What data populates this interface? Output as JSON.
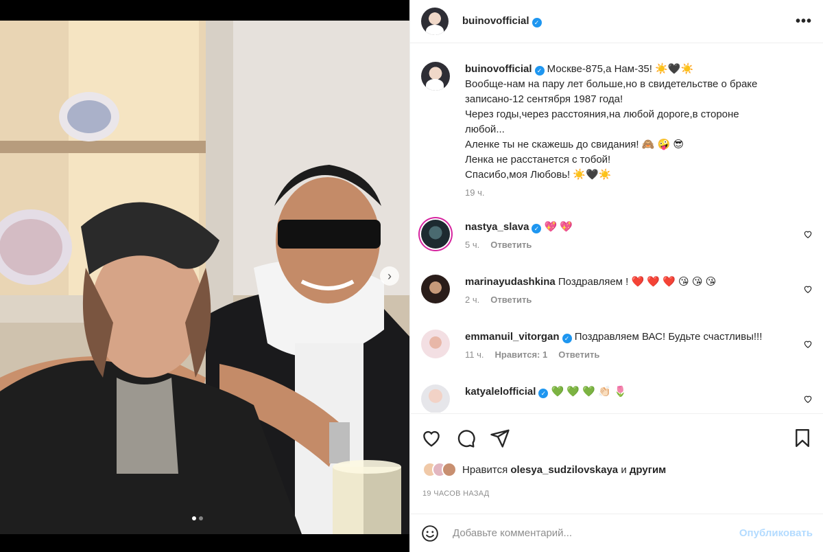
{
  "post": {
    "username": "buinovofficial",
    "verified_mark": "✓",
    "more_label": "•••",
    "caption_lines": [
      "Москве-875,а Нам-35! ☀️🖤☀️",
      "Вообще-нам на пару лет больше,но в свидетельстве о браке",
      "записано-12 сентября 1987 года!",
      "Через годы,через расстояния,на любой дороге,в стороне",
      "любой...",
      "Аленке ты не скажешь до свидания! 🙈 🤪 😎",
      "Ленка не расстанется с тобой!",
      "Спасибо,моя Любовь! ☀️🖤☀️"
    ],
    "caption_time": "19 ч."
  },
  "comments": [
    {
      "username": "nastya_slava",
      "verified": true,
      "text": "💖 💖",
      "time": "5 ч.",
      "likes": "",
      "reply": "Ответить"
    },
    {
      "username": "marinayudashkina",
      "verified": false,
      "text": "Поздравляем ! ❤️ ❤️ ❤️ 😘 😘 😘",
      "time": "2 ч.",
      "likes": "",
      "reply": "Ответить"
    },
    {
      "username": "emmanuil_vitorgan",
      "verified": true,
      "text": "Поздравляем ВАС! Будьте счастливы!!!",
      "time": "11 ч.",
      "likes": "Нравится: 1",
      "reply": "Ответить"
    },
    {
      "username": "katyalelofficial",
      "verified": true,
      "text": "💚 💚 💚 👏🏻 🌷",
      "time": "",
      "likes": "",
      "reply": ""
    }
  ],
  "actions": {
    "icons": [
      "heart-icon",
      "comment-icon",
      "share-icon",
      "bookmark-icon"
    ],
    "likes_prefix": "Нравится",
    "likes_user": "olesya_sudzilovskaya",
    "likes_joiner": "и",
    "likes_suffix": "другим",
    "timestamp": "19 ЧАСОВ НАЗАД"
  },
  "add_comment": {
    "placeholder": "Добавьте комментарий...",
    "publish": "Опубликовать",
    "emoji_icon": "smiley-icon"
  },
  "media": {
    "slide_count": 2,
    "active_slide": 1,
    "next_arrow": "›"
  },
  "colors": {
    "verified": "#1e96f0",
    "publish_disabled": "#b3dbff",
    "muted": "#8e8e8e",
    "story_ring": "#d6249f"
  }
}
